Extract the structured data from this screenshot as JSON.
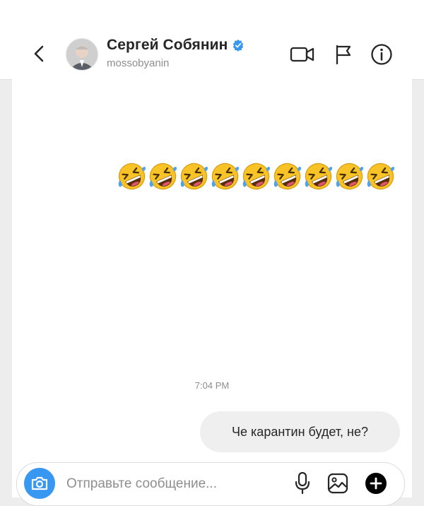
{
  "header": {
    "name": "Сергей Собянин",
    "username": "mossobyanin",
    "verified": true
  },
  "messages": {
    "emoji_count": 9,
    "emoji_name": "rolling-on-the-floor-laughing",
    "timestamp": "7:04 PM",
    "outgoing_text": "Че карантин будет, не?"
  },
  "composer": {
    "placeholder": "Отправьте сообщение...",
    "value": ""
  },
  "colors": {
    "accent": "#3897f0",
    "verified": "#3897f0",
    "text": "#262626",
    "muted": "#8e8e8e",
    "bubble": "#efefef"
  },
  "icons": {
    "back": "chevron-left-icon",
    "video": "video-camera-icon",
    "report": "flag-icon",
    "info": "info-icon",
    "camera": "camera-icon",
    "mic": "microphone-icon",
    "gallery": "image-icon",
    "more": "plus-icon"
  }
}
